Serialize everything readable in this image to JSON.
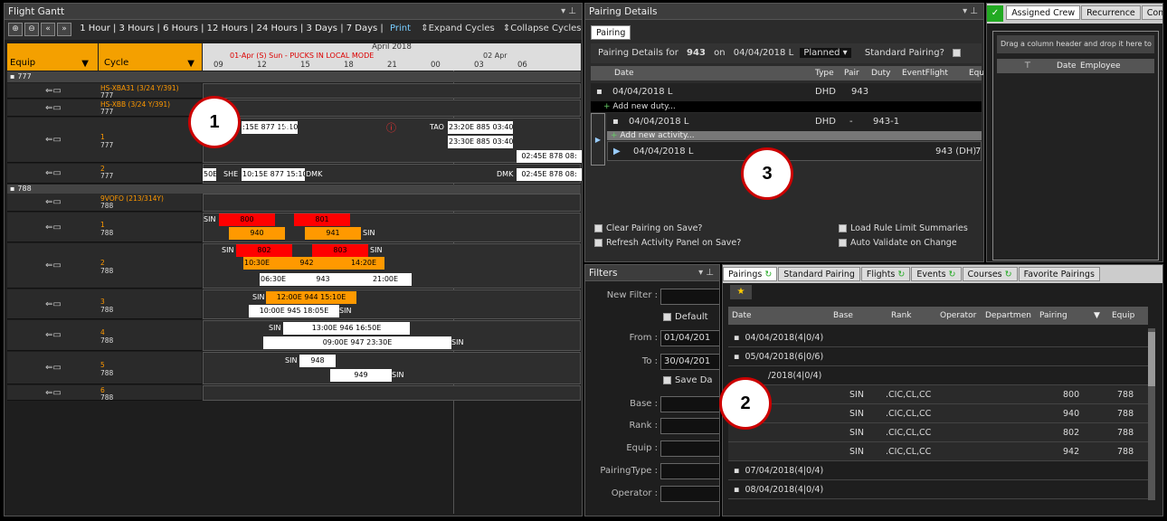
{
  "gantt": {
    "title": "Flight Gantt",
    "ranges": "1 Hour | 3 Hours | 6 Hours | 12 Hours | 24 Hours | 3 Days | 7 Days |",
    "print": "Print",
    "expand": "Expand Cycles",
    "collapse": "Collapse Cycles",
    "col_equip": "Equip",
    "col_cycle": "Cycle",
    "month": "April 2018",
    "day_label": "01-Apr (S) Sun - PUCKS IN LOCAL MODE",
    "day2": "02 Apr",
    "hours": [
      "09",
      "12",
      "15",
      "18",
      "21",
      "00",
      "03",
      "06"
    ]
  },
  "groups": {
    "g777": "777",
    "g788": "788"
  },
  "rows": [
    {
      "name": "HS-XBA31 (3/24 Y/391)",
      "sub": "777"
    },
    {
      "name": "HS-XBB (3/24 Y/391)",
      "sub": "777"
    },
    {
      "name": "1",
      "sub": "777"
    },
    {
      "name": "2",
      "sub": "777"
    },
    {
      "name": "9VOFO (213/314Y)",
      "sub": "788"
    },
    {
      "name": "1",
      "sub": "788"
    },
    {
      "name": "2",
      "sub": "788"
    },
    {
      "name": "3",
      "sub": "788"
    },
    {
      "name": "4",
      "sub": "788"
    },
    {
      "name": "5",
      "sub": "788"
    },
    {
      "name": "6",
      "sub": "788"
    }
  ],
  "bars": {
    "r1a": ":15E  877  15:10E",
    "r1a_dmk": "DMK",
    "r1b_tao": "TAO",
    "r1b": "23:20E  885  03:40E",
    "r1c": "23:30E  885  03:40E",
    "r1d": "02:45E  878  08:",
    "r2_50e": "50E",
    "r2_she": "SHE",
    "r2a": "10:15E  877  15:10E",
    "r2_dmk": "DMK",
    "r2_dmk2": "DMK",
    "r2b": "02:45E  878  08:",
    "s1_sin": "SIN",
    "s1a": "800",
    "s1b": "801",
    "s1c": "940",
    "s1d": "941",
    "s1_sin2": "SIN",
    "s2_sin": "SIN",
    "s2a": "802",
    "s2b": "803",
    "s2_sin2": "SIN",
    "s2c": "10:30E",
    "s2d": "942",
    "s2e": "14:20E",
    "s2f": "06:30E",
    "s2g": "943",
    "s2h": "21:00E",
    "s3_sin": "SIN",
    "s3a": "12:00E  944  15:10E",
    "s3b": "10:00E  945  18:05E",
    "s3_sin2": "SIN",
    "s4_sin": "SIN",
    "s4a": "13:00E  946  16:50E",
    "s4b": "09:00E  947  23:30E",
    "s4_sin2": "SIN",
    "s5_sin": "SIN",
    "s5a": "948",
    "s5b": "949",
    "s5_sin2": "SIN"
  },
  "pairing": {
    "title": "Pairing Details",
    "tab": "Pairing",
    "details_prefix": "Pairing Details for",
    "pnum": "943",
    "on": "on",
    "pdate": "04/04/2018 L",
    "status": "Planned",
    "std": "Standard Pairing?",
    "cols": [
      "Date",
      "Type",
      "Pair",
      "Duty",
      "EventFlight",
      "Equ"
    ],
    "r1_date": "04/04/2018 L",
    "r1_type": "DHD",
    "r1_pair": "943",
    "add_duty": "Add new duty...",
    "r2_date": "04/04/2018 L",
    "r2_type": "DHD",
    "r2_pair": "-",
    "r2_duty": "943-1",
    "add_act": "Add new activity...",
    "r3_date": "04/04/2018 L",
    "r3_ev": "943 (DH)",
    "r3_x": "7",
    "opt1": "Clear Pairing on Save?",
    "opt2": "Refresh Activity Panel on Save?",
    "opt3": "Load Rule Limit Summaries",
    "opt4": "Auto Validate on Change"
  },
  "crew": {
    "tabs": [
      "Assigned Crew",
      "Recurrence",
      "Comp"
    ],
    "drag": "Drag a column header and drop it here to",
    "cols": [
      "Date",
      "Employee"
    ]
  },
  "filters": {
    "title": "Filters",
    "new_filter": "New Filter :",
    "default": "Default",
    "from": "From :",
    "from_val": "01/04/201",
    "to": "To :",
    "to_val": "30/04/201",
    "save": "Save Da",
    "base": "Base :",
    "rank": "Rank :",
    "equip": "Equip :",
    "ptype": "PairingType :",
    "op": "Operator :"
  },
  "pairings": {
    "tabs": [
      "Pairings",
      "Standard Pairing",
      "Flights",
      "Events",
      "Courses",
      "Favorite Pairings"
    ],
    "cols": [
      "Date",
      "Base",
      "Rank",
      "Operator",
      "Departmen",
      "Pairing",
      "Equip"
    ],
    "g1": "04/04/2018(4|0/4)",
    "g2": "05/04/2018(6|0/6)",
    "g3": "/2018(4|0/4)",
    "g4": "07/04/2018(4|0/4)",
    "g5": "08/04/2018(4|0/4)",
    "rows": [
      {
        "base": "SIN",
        "rank": ".CIC,CL,CC",
        "pairing": "800",
        "equip": "788"
      },
      {
        "base": "SIN",
        "rank": ".CIC,CL,CC",
        "pairing": "940",
        "equip": "788"
      },
      {
        "base": "SIN",
        "rank": ".CIC,CL,CC",
        "pairing": "802",
        "equip": "788"
      },
      {
        "base": "SIN",
        "rank": ".CIC,CL,CC",
        "pairing": "942",
        "equip": "788"
      }
    ]
  },
  "callouts": [
    "1",
    "2",
    "3"
  ]
}
